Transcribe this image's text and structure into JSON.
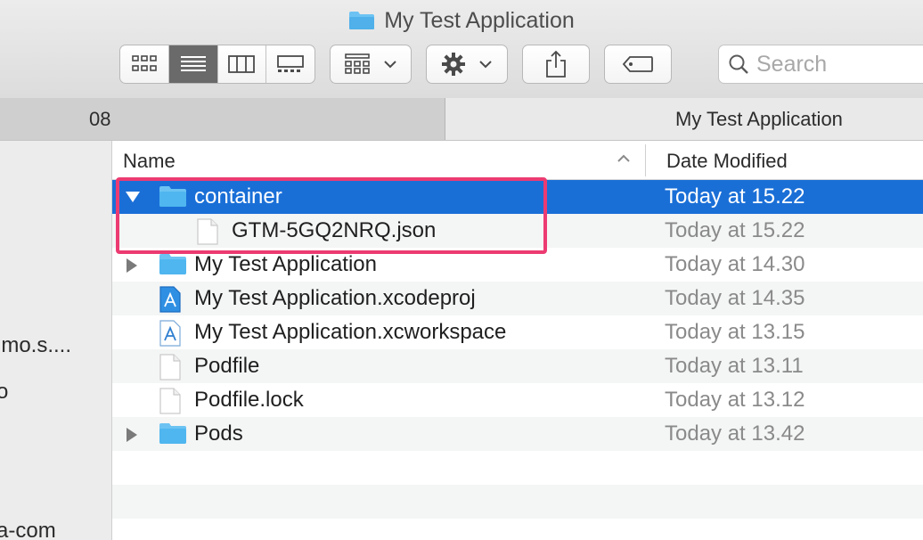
{
  "window": {
    "title": "My Test Application"
  },
  "toolbar": {
    "view_buttons": [
      {
        "icon": "icon-view-icon",
        "active": false
      },
      {
        "icon": "list-view-icon",
        "active": true
      },
      {
        "icon": "column-view-icon",
        "active": false
      },
      {
        "icon": "gallery-view-icon",
        "active": false
      }
    ],
    "group_icon": "group-by-icon",
    "action_icon": "gear-icon",
    "share_icon": "share-icon",
    "tag_icon": "tag-icon",
    "search": {
      "placeholder": "Search",
      "value": ""
    }
  },
  "tabs": [
    {
      "label": "08"
    },
    {
      "label": "My Test Application"
    }
  ],
  "sidebar": {
    "items": [
      {
        "label": "imo.s...."
      },
      {
        "label": "o"
      },
      {
        "label": "a-com"
      }
    ]
  },
  "file_list": {
    "columns": {
      "name": "Name",
      "date": "Date Modified"
    },
    "rows": [
      {
        "name": "container",
        "date": "Today at 15.22",
        "kind": "folder",
        "disclosure": "expanded",
        "indent": 0,
        "selected": true
      },
      {
        "name": "GTM-5GQ2NRQ.json",
        "date": "Today at 15.22",
        "kind": "file",
        "disclosure": "none",
        "indent": 1,
        "selected": false
      },
      {
        "name": "My Test Application",
        "date": "Today at 14.30",
        "kind": "folder",
        "disclosure": "collapsed",
        "indent": 0,
        "selected": false
      },
      {
        "name": "My Test Application.xcodeproj",
        "date": "Today at 14.35",
        "kind": "xcode",
        "disclosure": "none",
        "indent": 0,
        "selected": false
      },
      {
        "name": "My Test Application.xcworkspace",
        "date": "Today at 13.15",
        "kind": "xcode-workspace",
        "disclosure": "none",
        "indent": 0,
        "selected": false
      },
      {
        "name": "Podfile",
        "date": "Today at 13.11",
        "kind": "file",
        "disclosure": "none",
        "indent": 0,
        "selected": false
      },
      {
        "name": "Podfile.lock",
        "date": "Today at 13.12",
        "kind": "file",
        "disclosure": "none",
        "indent": 0,
        "selected": false
      },
      {
        "name": "Pods",
        "date": "Today at 13.42",
        "kind": "folder",
        "disclosure": "collapsed",
        "indent": 0,
        "selected": false
      }
    ]
  },
  "colors": {
    "selection": "#1a6fd7",
    "highlight_box": "#ec3b72",
    "folder": "#4fb6ef"
  }
}
